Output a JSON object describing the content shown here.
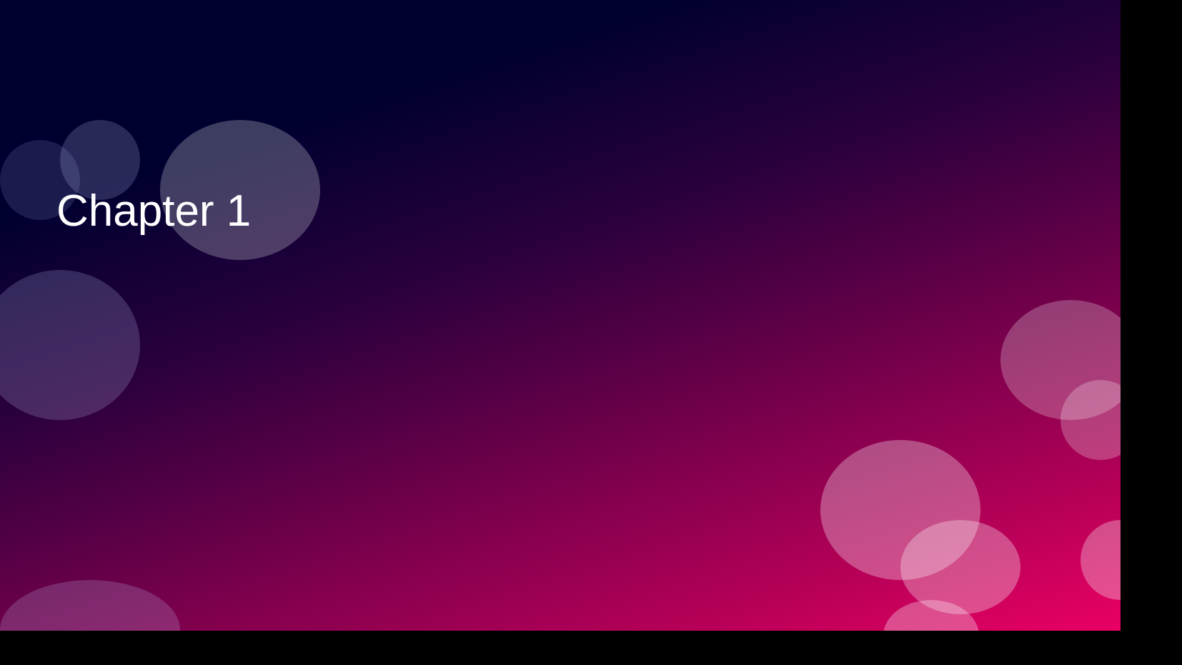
{
  "slide": {
    "title": "Chapter 1",
    "background_colors": [
      "#000030",
      "#2a003e",
      "#8a004f",
      "#ea0064"
    ],
    "decoration": "translucent-bubbles"
  }
}
